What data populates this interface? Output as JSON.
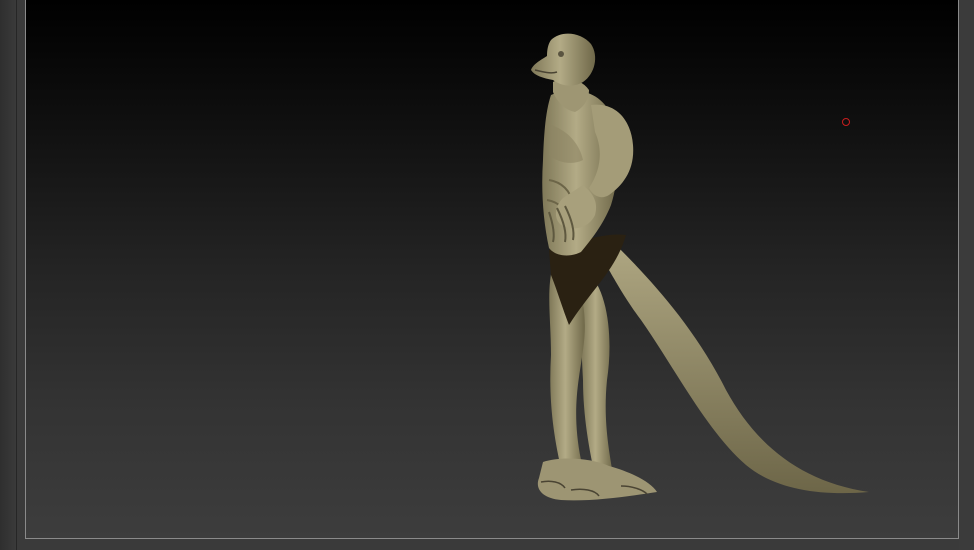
{
  "viewport": {
    "model_icon": "sculpt-model-lizard-figure",
    "cursor_icon": "brush-cursor-icon",
    "cursor_color": "#c81e1e",
    "model_color": "#a8a07c",
    "background_top": "#000000",
    "background_bottom": "#3d3d3d"
  }
}
